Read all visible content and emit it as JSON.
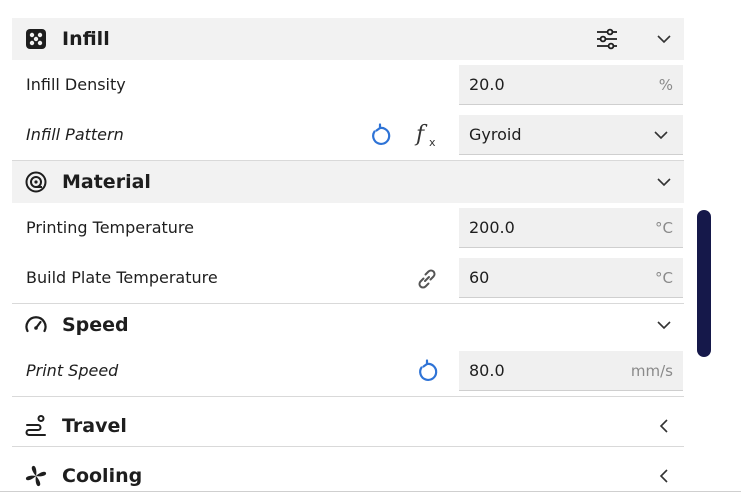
{
  "sections": {
    "infill": {
      "title": "Infill",
      "icon": "infill-pattern-icon",
      "rows": {
        "density": {
          "label": "Infill Density",
          "value": "20.0",
          "unit": "%"
        },
        "pattern": {
          "label": "Infill Pattern",
          "value": "Gyroid"
        }
      }
    },
    "material": {
      "title": "Material",
      "icon": "material-spool-icon",
      "rows": {
        "print_temp": {
          "label": "Printing Temperature",
          "value": "200.0",
          "unit": "°C"
        },
        "bed_temp": {
          "label": "Build Plate Temperature",
          "value": "60",
          "unit": "°C"
        }
      }
    },
    "speed": {
      "title": "Speed",
      "icon": "speedometer-icon",
      "rows": {
        "print_speed": {
          "label": "Print Speed",
          "value": "80.0",
          "unit": "mm/s"
        }
      }
    },
    "travel": {
      "title": "Travel",
      "icon": "travel-icon"
    },
    "cooling": {
      "title": "Cooling",
      "icon": "fan-icon"
    }
  },
  "colors": {
    "accent_blue": "#2e73d6",
    "scrollbar": "#15184a",
    "header_bg": "#f2f2f2",
    "field_bg": "#f0f0f0"
  }
}
